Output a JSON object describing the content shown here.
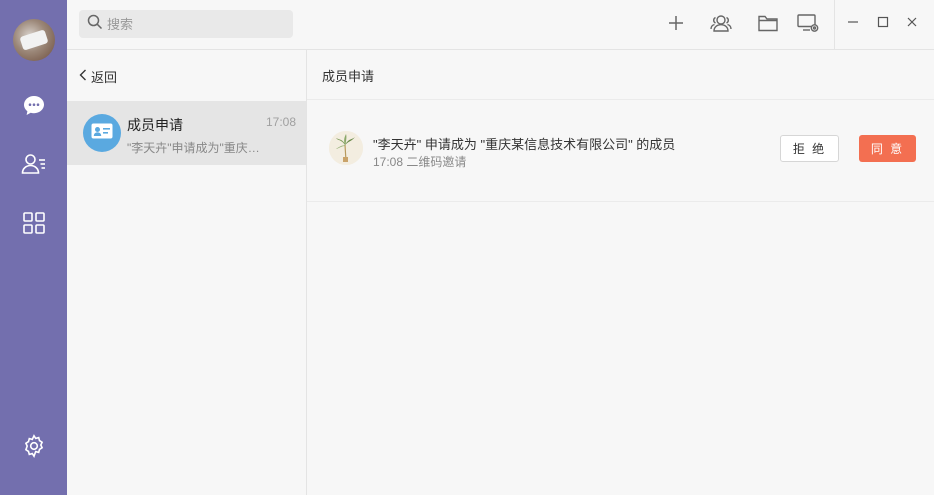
{
  "colors": {
    "rail": "#736fae",
    "accept": "#f36f51",
    "list_avatar": "#5aa9e0",
    "selected_row": "#e5e5e5"
  },
  "rail": {
    "avatar": "user-avatar-photo",
    "items": [
      {
        "name": "chat-icon"
      },
      {
        "name": "contacts-icon"
      },
      {
        "name": "apps-grid-icon"
      }
    ],
    "bottom": {
      "name": "settings-icon"
    }
  },
  "topbar": {
    "search_placeholder": "搜索",
    "icons": [
      "plus-icon",
      "group-icon",
      "folder-icon",
      "screen-share-icon"
    ],
    "window_controls": [
      "minimize-icon",
      "maximize-icon",
      "close-icon"
    ]
  },
  "list": {
    "back_label": "返回",
    "items": [
      {
        "title": "成员申请",
        "time": "17:08",
        "preview": "\"李天卉\"申请成为\"重庆…"
      }
    ]
  },
  "content": {
    "title": "成员申请",
    "request": {
      "text": "\"李天卉\" 申请成为 \"重庆某信息技术有限公司\" 的成员",
      "meta": "17:08 二维码邀请",
      "reject_label": "拒 绝",
      "accept_label": "同 意"
    }
  }
}
